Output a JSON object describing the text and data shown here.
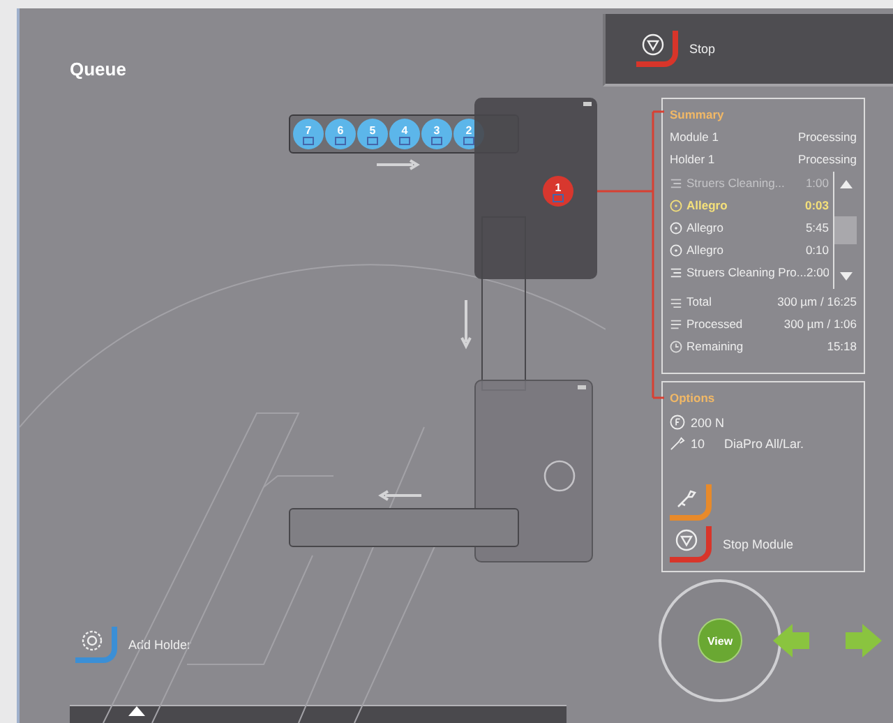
{
  "screen": {
    "title": "Queue"
  },
  "top_bar": {
    "stop_button": {
      "kind": "stop",
      "label": "Stop"
    }
  },
  "holders": [
    {
      "number": "7",
      "kind": "queued",
      "color": "#5cb6ea"
    },
    {
      "number": "6",
      "kind": "queued",
      "color": "#5cb6ea"
    },
    {
      "number": "5",
      "kind": "queued",
      "color": "#5cb6ea"
    },
    {
      "number": "4",
      "kind": "queued",
      "color": "#5cb6ea"
    },
    {
      "number": "3",
      "kind": "queued",
      "color": "#5cb6ea"
    },
    {
      "number": "2",
      "kind": "queued",
      "color": "#5cb6ea"
    },
    {
      "number": "1",
      "kind": "processing",
      "color": "#d8372e"
    }
  ],
  "summary": {
    "title": "Summary",
    "status": [
      {
        "label": "Module 1",
        "value": "Processing"
      },
      {
        "label": "Holder 1",
        "value": "Processing"
      }
    ],
    "queue": [
      {
        "kind": "cleaning",
        "name": "Struers Cleaning...",
        "time": "1:00",
        "selected": false,
        "dimmed": true
      },
      {
        "kind": "method",
        "name": "Allegro",
        "time": "0:03",
        "selected": true,
        "dimmed": false
      },
      {
        "kind": "method",
        "name": "Allegro",
        "time": "5:45",
        "selected": false,
        "dimmed": false
      },
      {
        "kind": "method",
        "name": "Allegro",
        "time": "0:10",
        "selected": false,
        "dimmed": false
      },
      {
        "kind": "cleaning",
        "name": "Struers Cleaning Pro...",
        "time": "2:00",
        "selected": false,
        "dimmed": false
      }
    ],
    "totals": [
      {
        "kind": "total",
        "label": "Total",
        "value": "300 µm / 16:25"
      },
      {
        "kind": "processed",
        "label": "Processed",
        "value": "300 µm / 1:06"
      },
      {
        "kind": "remaining",
        "label": "Remaining",
        "value": "15:18"
      }
    ]
  },
  "options": {
    "title": "Options",
    "force": "200 N",
    "count": "10",
    "consumable": "DiaPro All/Lar.",
    "buttons": [
      {
        "kind": "tool"
      },
      {
        "kind": "stop",
        "label": "Stop Module"
      }
    ]
  },
  "add_holder": {
    "kind": "add",
    "label": "Add Holder"
  },
  "view_button": {
    "label": "View"
  }
}
